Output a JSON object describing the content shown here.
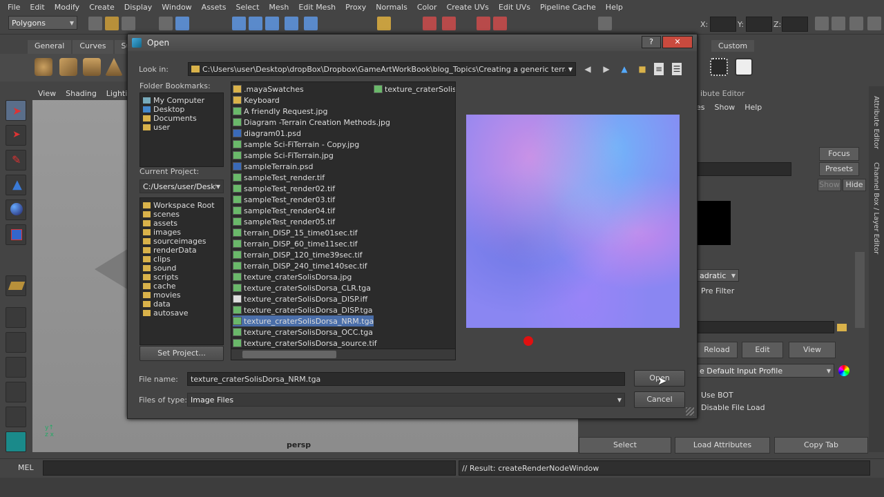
{
  "maya": {
    "menu": [
      "File",
      "Edit",
      "Modify",
      "Create",
      "Display",
      "Window",
      "Assets",
      "Select",
      "Mesh",
      "Edit Mesh",
      "Proxy",
      "Normals",
      "Color",
      "Create UVs",
      "Edit UVs",
      "Pipeline Cache",
      "Help"
    ],
    "mode_combo": "Polygons",
    "coord_labels": {
      "x": "X:",
      "y": "Y:",
      "z": "Z:"
    },
    "shelf_tabs": [
      "General",
      "Curves",
      "Su"
    ],
    "shelf_tab_custom": "Custom",
    "viewport_menu": [
      "View",
      "Shading",
      "Lighting"
    ],
    "camera_label": "persp",
    "attr_editor_title": "ibute Editor",
    "attr_menu": [
      "es",
      "Show",
      "Help"
    ],
    "focus_label": "Focus",
    "presets_label": "Presets",
    "show_label": "Show",
    "hide_label": "Hide",
    "quadratic_label": "adratic",
    "pre_filter_label": "Pre Filter",
    "reload_label": "Reload",
    "edit_label": "Edit",
    "view_label": "View",
    "input_profile": "e Default Input Profile",
    "use_bot_label": "Use BOT",
    "disable_file_load_label": "Disable File Load",
    "select_label": "Select",
    "load_attributes_label": "Load Attributes",
    "copy_tab_label": "Copy Tab",
    "side_tab_attr": "Attribute Editor",
    "side_tab_channel": "Channel Box / Layer Editor",
    "mel_label": "MEL",
    "result_text": "// Result: createRenderNodeWindow"
  },
  "dialog": {
    "title": "Open",
    "help_btn": "?",
    "close_btn": "✕",
    "look_in_label": "Look in:",
    "look_in_path": "C:\\Users\\user\\Desktop\\dropBox\\Dropbox\\GameArtWorkBook\\blog_Topics\\Creating a generic terrain\\source",
    "folder_bookmarks_label": "Folder Bookmarks:",
    "bookmarks": [
      "My Computer",
      "Desktop",
      "Documents",
      "user"
    ],
    "current_project_label": "Current Project:",
    "current_project": "C:/Users/user/Deskt",
    "project_folders": [
      "Workspace Root",
      "scenes",
      "assets",
      "images",
      "sourceimages",
      "renderData",
      "clips",
      "sound",
      "scripts",
      "cache",
      "movies",
      "data",
      "autosave"
    ],
    "set_project_label": "Set Project...",
    "files_col1": [
      ".mayaSwatches",
      "Keyboard",
      "A friendly Request.jpg",
      "Diagram -Terrain Creation Methods.jpg",
      "diagram01.psd",
      "sample Sci-FiTerrain - Copy.jpg",
      "sample Sci-FiTerrain.jpg",
      "sampleTerrain.psd",
      "sampleTest_render.tif",
      "sampleTest_render02.tif",
      "sampleTest_render03.tif",
      "sampleTest_render04.tif",
      "sampleTest_render05.tif",
      "terrain_DISP_15_time01sec.tif",
      "terrain_DISP_60_time11sec.tif",
      "terrain_DISP_120_time39sec.tif",
      "terrain_DISP_240_time140sec.tif",
      "texture_craterSolisDorsa.jpg",
      "texture_craterSolisDorsa_CLR.tga",
      "texture_craterSolisDorsa_DISP.iff",
      "texture_craterSolisDorsa_DISP.tga",
      "texture_craterSolisDorsa_NRM.tga",
      "texture_craterSolisDorsa_OCC.tga",
      "texture_craterSolisDorsa_source.tif"
    ],
    "files_col2": [
      "texture_craterSolisDo"
    ],
    "selected_file_index": 21,
    "file_name_label": "File name:",
    "file_name_value": "texture_craterSolisDorsa_NRM.tga",
    "files_of_type_label": "Files of type:",
    "files_of_type_value": "Image Files",
    "open_label": "Open",
    "cancel_label": "Cancel"
  },
  "colors": {
    "selection": "#4a6ea9",
    "cursor_marker": "#e01010",
    "folder": "#d9b24a"
  }
}
